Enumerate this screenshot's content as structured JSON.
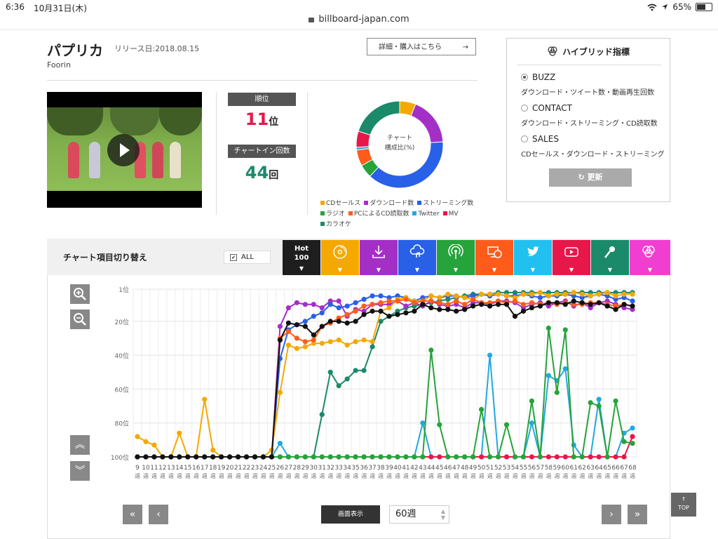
{
  "status_bar": {
    "time": "6:36",
    "date": "10月31日(木)",
    "battery": "65%"
  },
  "url": "billboard-japan.com",
  "song": {
    "title": "パプリカ",
    "release": "リリース日:2018.08.15",
    "artist": "Foorin",
    "detail_button": "詳細・購入はこちら",
    "detail_arrow": "→"
  },
  "rank": {
    "label": "順位",
    "value": "11",
    "unit": "位"
  },
  "chart_in": {
    "label": "チャートイン回数",
    "value": "44",
    "unit": "回"
  },
  "donut": {
    "center_line1": "チャート",
    "center_line2": "構成比(%)",
    "segments": [
      {
        "name": "CDセールス",
        "color": "#f5a800",
        "value": 6
      },
      {
        "name": "ダウンロード数",
        "color": "#a42fc7",
        "value": 18
      },
      {
        "name": "ストリーミング数",
        "color": "#2860e8",
        "value": 38
      },
      {
        "name": "ラジオ",
        "color": "#26a33a",
        "value": 5
      },
      {
        "name": "PCによるCD読取数",
        "color": "#ff5c1c",
        "value": 6
      },
      {
        "name": "Twitter",
        "color": "#22a8e0",
        "value": 1
      },
      {
        "name": "MV",
        "color": "#e8174a",
        "value": 6
      },
      {
        "name": "カラオケ",
        "color": "#1a8a6a",
        "value": 20
      }
    ]
  },
  "hybrid": {
    "title": "ハイブリッド指標",
    "options": [
      {
        "label": "BUZZ",
        "desc": "ダウンロード・ツイート数・動画再生回数",
        "selected": true
      },
      {
        "label": "CONTACT",
        "desc": "ダウンロード・ストリーミング・CD読取数",
        "selected": false
      },
      {
        "label": "SALES",
        "desc": "CDセールス・ダウンロード・ストリーミング",
        "selected": false
      }
    ],
    "refresh": "更新",
    "refresh_icon": "↻"
  },
  "panel": {
    "switch_label": "チャート項目切り替え",
    "all_label": "ALL",
    "all_checked": "✔",
    "hot_line1": "Hot",
    "hot_line2": "100",
    "tab_colors": [
      "#1e1e1e",
      "#f5a800",
      "#a42fc7",
      "#2860e8",
      "#26a33a",
      "#ff5c1c",
      "#22c0f0",
      "#e8174a",
      "#1a8a6a",
      "#f23ed0"
    ]
  },
  "controls": {
    "screen_label": "画面表示",
    "weeks_value": "60週",
    "zoom_in": "+",
    "zoom_out": "−",
    "first": "«",
    "prev": "‹",
    "next": "›",
    "last": "»",
    "up": "︽",
    "down": "︾",
    "top_arrow": "↑",
    "top_label": "TOP"
  },
  "chart_data": {
    "type": "line",
    "x": [
      "9",
      "10",
      "11",
      "12",
      "13",
      "14",
      "15",
      "16",
      "17",
      "18",
      "19",
      "20",
      "21",
      "22",
      "23",
      "24",
      "25",
      "26",
      "27",
      "28",
      "29",
      "30",
      "31",
      "32",
      "33",
      "34",
      "35",
      "36",
      "37",
      "38",
      "39",
      "40",
      "41",
      "42",
      "43",
      "44",
      "45",
      "46",
      "47",
      "48",
      "49",
      "50",
      "51",
      "52",
      "53",
      "54",
      "55",
      "56",
      "57",
      "58",
      "59",
      "60",
      "61",
      "62",
      "63",
      "64",
      "65",
      "66",
      "67",
      "68"
    ],
    "x_unit": "週",
    "y_ticks": [
      "1位",
      "20位",
      "40位",
      "60位",
      "80位",
      "100位"
    ],
    "y_reversed": true,
    "ylim": [
      1,
      100
    ],
    "series": [
      {
        "name": "カラオケ",
        "color": "#1a8a6a",
        "values": [
          100,
          100,
          100,
          100,
          100,
          100,
          100,
          100,
          100,
          100,
          100,
          100,
          100,
          100,
          100,
          100,
          100,
          100,
          100,
          100,
          100,
          100,
          75,
          50,
          58,
          54,
          49,
          49,
          35,
          20,
          17,
          14,
          12,
          11,
          10,
          9,
          8,
          7,
          6,
          5,
          4,
          4,
          4,
          3,
          3,
          3,
          3,
          3,
          3,
          3,
          3,
          3,
          3,
          3,
          3,
          3,
          3,
          3,
          3,
          3
        ]
      },
      {
        "name": "ダウンロード数",
        "color": "#a42fc7",
        "values": [
          100,
          100,
          100,
          100,
          100,
          100,
          100,
          100,
          100,
          100,
          100,
          100,
          100,
          100,
          100,
          100,
          100,
          23,
          12,
          9,
          10,
          10,
          12,
          8,
          8,
          17,
          13,
          14,
          10,
          10,
          10,
          8,
          11,
          9,
          11,
          8,
          10,
          11,
          10,
          12,
          9,
          9,
          10,
          8,
          8,
          9,
          12,
          10,
          9,
          11,
          9,
          8,
          11,
          9,
          12,
          9,
          8,
          10,
          12,
          13
        ]
      },
      {
        "name": "ストリーミング数",
        "color": "#2860e8",
        "values": [
          100,
          100,
          100,
          100,
          100,
          100,
          100,
          100,
          100,
          100,
          100,
          100,
          100,
          100,
          100,
          100,
          100,
          42,
          25,
          22,
          20,
          17,
          15,
          10,
          12,
          11,
          9,
          7,
          5,
          5,
          6,
          5,
          6,
          8,
          6,
          5,
          6,
          5,
          5,
          6,
          5,
          4,
          5,
          4,
          5,
          5,
          4,
          5,
          6,
          5,
          5,
          4,
          5,
          6,
          5,
          4,
          5,
          7,
          6,
          8
        ]
      },
      {
        "name": "CDセールス",
        "color": "#f5a800",
        "values": [
          88,
          91,
          93,
          100,
          100,
          86,
          100,
          100,
          66,
          96,
          100,
          100,
          100,
          100,
          100,
          100,
          96,
          62,
          34,
          36,
          35,
          33,
          33,
          32,
          31,
          34,
          32,
          31,
          32,
          14,
          12,
          7,
          6,
          8,
          8,
          5,
          6,
          4,
          5,
          6,
          7,
          4,
          4,
          4,
          5,
          6,
          4,
          4,
          3,
          5,
          4,
          4,
          3,
          4,
          5,
          4,
          3,
          5,
          4,
          4
        ]
      },
      {
        "name": "PCによるCD読取数",
        "color": "#ff5c1c",
        "values": [
          100,
          100,
          100,
          100,
          100,
          100,
          100,
          100,
          100,
          100,
          100,
          100,
          100,
          100,
          100,
          100,
          100,
          30,
          26,
          30,
          32,
          31,
          23,
          21,
          18,
          16,
          14,
          11,
          10,
          9,
          8,
          8,
          7,
          9,
          8,
          8,
          9,
          10,
          8,
          10,
          7,
          9,
          9,
          8,
          9,
          8,
          10,
          9,
          10,
          9,
          10,
          9,
          10,
          10,
          9,
          9,
          10,
          11,
          10,
          11
        ]
      },
      {
        "name": "Twitter",
        "color": "#22a8e0",
        "values": [
          100,
          100,
          100,
          100,
          100,
          100,
          100,
          100,
          100,
          100,
          100,
          100,
          100,
          100,
          100,
          100,
          100,
          92,
          100,
          100,
          100,
          100,
          100,
          100,
          100,
          100,
          100,
          100,
          100,
          100,
          100,
          100,
          100,
          100,
          80,
          100,
          100,
          100,
          100,
          100,
          100,
          100,
          40,
          100,
          100,
          100,
          100,
          80,
          100,
          52,
          55,
          48,
          93,
          100,
          100,
          66,
          100,
          100,
          86,
          83
        ]
      },
      {
        "name": "MV",
        "color": "#e8174a",
        "values": [
          100,
          100,
          100,
          100,
          100,
          100,
          100,
          100,
          100,
          100,
          100,
          100,
          100,
          100,
          100,
          100,
          100,
          100,
          100,
          100,
          100,
          100,
          100,
          100,
          100,
          100,
          100,
          100,
          100,
          100,
          100,
          100,
          100,
          100,
          100,
          100,
          100,
          100,
          100,
          100,
          100,
          100,
          100,
          100,
          100,
          100,
          100,
          100,
          100,
          100,
          100,
          100,
          100,
          100,
          100,
          100,
          100,
          100,
          100,
          88
        ]
      },
      {
        "name": "ラジオ",
        "color": "#26a33a",
        "values": [
          100,
          100,
          100,
          100,
          100,
          100,
          100,
          100,
          100,
          100,
          100,
          100,
          100,
          100,
          100,
          100,
          100,
          100,
          100,
          100,
          100,
          100,
          100,
          100,
          100,
          100,
          100,
          100,
          100,
          100,
          100,
          100,
          100,
          100,
          100,
          37,
          81,
          100,
          100,
          100,
          100,
          72,
          100,
          100,
          81,
          100,
          100,
          67,
          100,
          24,
          62,
          25,
          100,
          100,
          68,
          70,
          100,
          67,
          91,
          92
        ]
      },
      {
        "name": "Hot 100",
        "color": "#111111",
        "values": [
          100,
          100,
          100,
          100,
          100,
          100,
          100,
          100,
          100,
          100,
          100,
          100,
          100,
          100,
          100,
          100,
          100,
          31,
          21,
          22,
          23,
          28,
          23,
          20,
          20,
          21,
          20,
          16,
          14,
          14,
          17,
          16,
          15,
          14,
          10,
          12,
          13,
          13,
          14,
          13,
          11,
          10,
          11,
          10,
          10,
          17,
          14,
          12,
          11,
          9,
          9,
          10,
          8,
          9,
          10,
          9,
          11,
          13,
          10,
          11
        ]
      }
    ]
  }
}
